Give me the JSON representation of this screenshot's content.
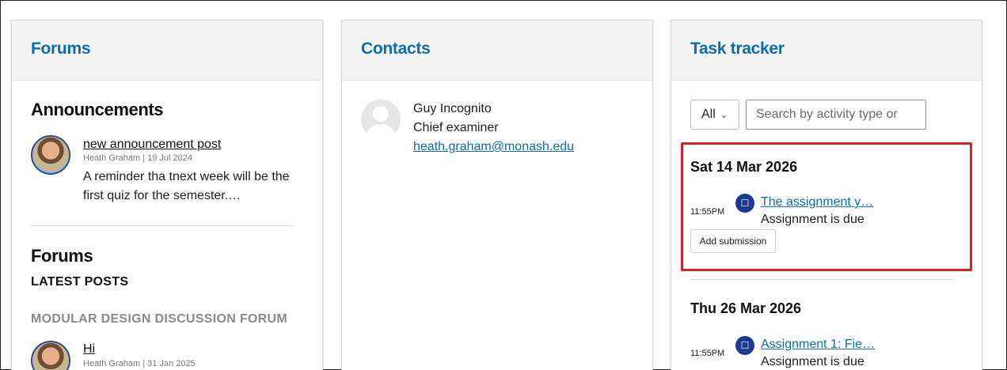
{
  "forums_block": {
    "title": "Forums",
    "announcements_heading": "Announcements",
    "announcement": {
      "title": "new announcement post",
      "meta": "Heath Graham | 19 Jul 2024",
      "body": "A reminder tha tnext week will be the first quiz for the semester.…"
    },
    "forums_heading": "Forums",
    "latest_posts_label": "LATEST POSTS",
    "forum_name": "MODULAR DESIGN DISCUSSION FORUM",
    "latest_post": {
      "title": "Hi",
      "meta": "Heath Graham | 31 Jan 2025"
    }
  },
  "contacts_block": {
    "title": "Contacts",
    "contact": {
      "name": "Guy Incognito",
      "role": "Chief examiner",
      "email": "heath.graham@monash.edu"
    }
  },
  "task_block": {
    "title": "Task tracker",
    "filter_value": "All",
    "search_placeholder": "Search by activity type or",
    "groups": [
      {
        "date": "Sat 14 Mar 2026",
        "time": "11:55PM",
        "link": "The assignment y…",
        "desc": "Assignment is due",
        "button": "Add submission"
      },
      {
        "date": "Thu 26 Mar 2026",
        "time": "11:55PM",
        "link": "Assignment 1: Fie…",
        "desc": "Assignment is due"
      }
    ]
  },
  "colors": {
    "accent": "#0f6cad",
    "highlight": "#d7222a",
    "icon_bg": "#1a3a8f"
  }
}
